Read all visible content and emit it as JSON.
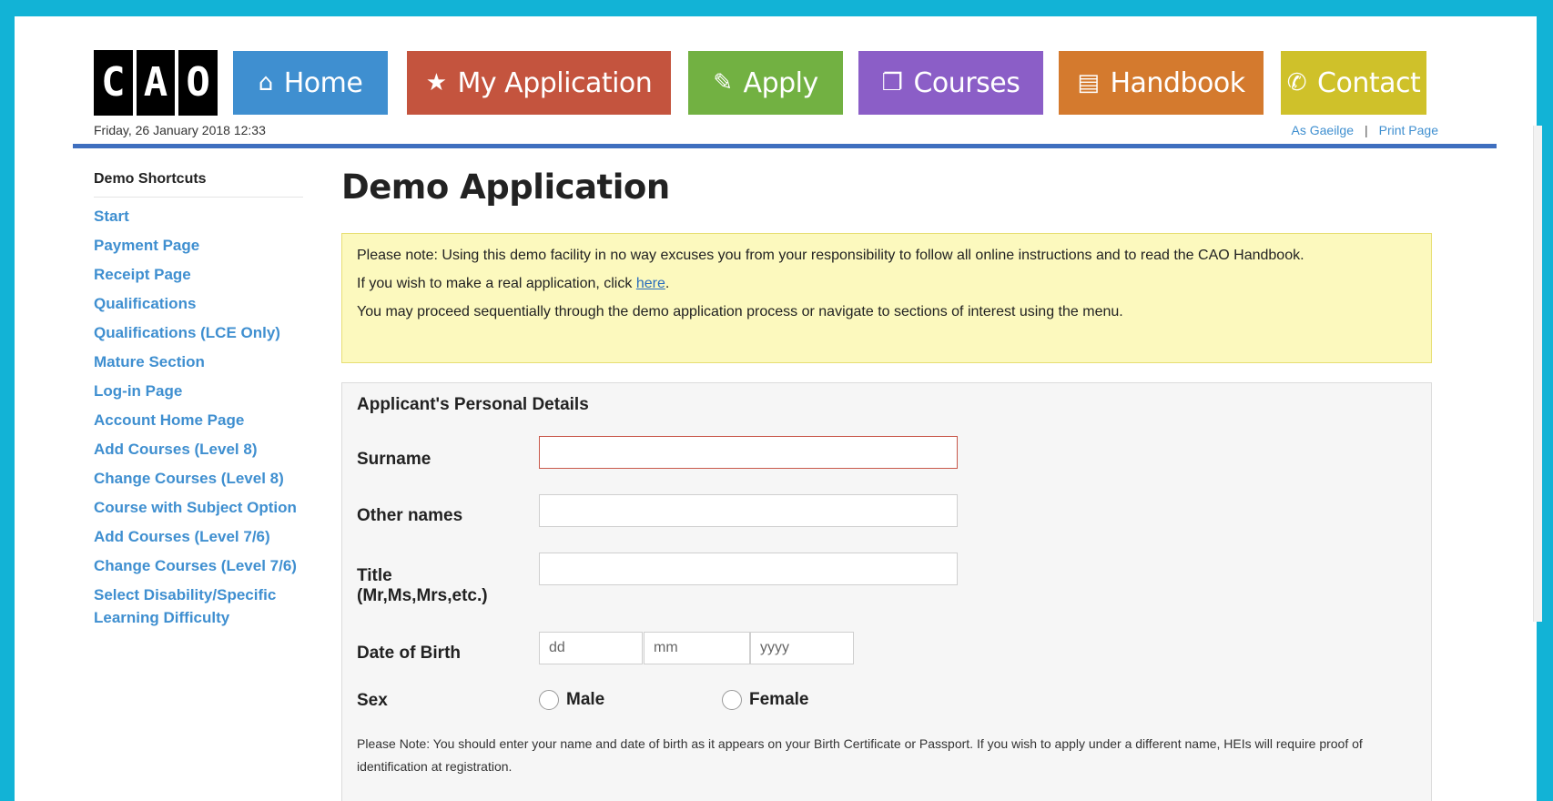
{
  "header": {
    "logo_text": "CAO",
    "date": "Friday, 26 January 2018 12:33",
    "links": {
      "irish": "As Gaeilge",
      "separator": "|",
      "print": "Print Page"
    }
  },
  "nav": {
    "home": {
      "label": "Home",
      "icon": "home-icon",
      "color": "#3f8fd0"
    },
    "my_application": {
      "label": "My Application",
      "icon": "star-icon",
      "color": "#c4543e"
    },
    "apply": {
      "label": "Apply",
      "icon": "edit-icon",
      "color": "#72b142"
    },
    "courses": {
      "label": "Courses",
      "icon": "courses-icon",
      "color": "#8b5ec7"
    },
    "handbook": {
      "label": "Handbook",
      "icon": "book-icon",
      "color": "#d47a2e"
    },
    "contact": {
      "label": "Contact",
      "icon": "phone-icon",
      "color": "#cfc12a"
    }
  },
  "sidebar": {
    "title": "Demo Shortcuts",
    "items": [
      "Start",
      "Payment Page",
      "Receipt Page",
      "Qualifications",
      "Qualifications (LCE Only)",
      "Mature Section",
      "Log-in Page",
      "Account Home Page",
      "Add Courses (Level 8)",
      "Change Courses (Level 8)",
      "Course with Subject Option",
      "Add Courses (Level 7/6)",
      "Change Courses (Level 7/6)",
      "Select Disability/Specific Learning Difficulty"
    ]
  },
  "main": {
    "title": "Demo Application",
    "notice": {
      "p1": "Please note: Using this demo facility in no way excuses you from your responsibility to follow all online instructions and to read the CAO Handbook.",
      "p2_prefix": "If you wish to make a real application, click ",
      "p2_link": "here",
      "p2_suffix": ".",
      "p3": "You may proceed sequentially through the demo application process or navigate to sections of interest using the menu."
    },
    "form": {
      "title": "Applicant's Personal Details",
      "surname_label": "Surname",
      "other_names_label": "Other names",
      "title_label_line1": "Title",
      "title_label_line2": "(Mr,Ms,Mrs,etc.)",
      "dob_label": "Date of Birth",
      "dob_placeholders": {
        "day": "dd",
        "month": "mm",
        "year": "yyyy"
      },
      "sex_label": "Sex",
      "sex_options": {
        "male": "Male",
        "female": "Female"
      },
      "note": "Please Note: You should enter your name and date of birth as it appears on your Birth Certificate or Passport. If you wish to apply under a different name, HEIs will require proof of identification at registration."
    }
  },
  "colors": {
    "frame": "#12b3d6",
    "link": "#3f8fd0",
    "notice_bg": "#fcf9be",
    "error_border": "#c8584a"
  }
}
